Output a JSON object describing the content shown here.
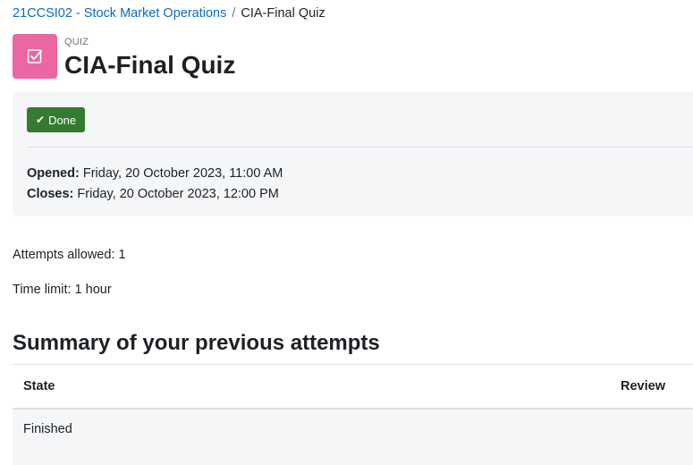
{
  "breadcrumb": {
    "course": "21CCSI02 - Stock Market Operations",
    "separator": "/",
    "current": "CIA-Final Quiz"
  },
  "header": {
    "icon": "quiz-checkbox-icon",
    "icon_color": "#eb66a2",
    "pretitle": "QUIZ",
    "title": "CIA-Final Quiz"
  },
  "completion": {
    "done_label": "Done",
    "done_color": "#357a32"
  },
  "dates": {
    "opened_label": "Opened:",
    "opened_value": "Friday, 20 October 2023, 11:00 AM",
    "closes_label": "Closes:",
    "closes_value": "Friday, 20 October 2023, 12:00 PM"
  },
  "quiz_info": {
    "attempts_allowed": "Attempts allowed: 1",
    "time_limit": "Time limit: 1 hour"
  },
  "summary": {
    "heading": "Summary of your previous attempts",
    "columns": [
      "State",
      "Review"
    ],
    "rows": [
      {
        "state": "Finished",
        "review": ""
      }
    ]
  },
  "colors": {
    "link": "#0f6cbf",
    "panel_background": "#f5f6f7"
  }
}
